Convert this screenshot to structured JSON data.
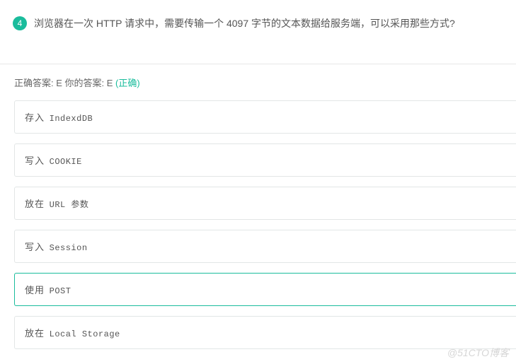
{
  "question": {
    "number": "4",
    "text": "浏览器在一次 HTTP 请求中，需要传输一个 4097 字节的文本数据给服务端，可以采用那些方式?"
  },
  "answer": {
    "correct_prefix": "正确答案: ",
    "correct_value": "E",
    "your_prefix": "   你的答案: ",
    "your_value": "E ",
    "status_open": "(",
    "status_text": "正确",
    "status_close": ")"
  },
  "options": [
    {
      "label": "存入 ",
      "code": "IndexdDB",
      "selected": false
    },
    {
      "label": "写入 ",
      "code": "COOKIE",
      "selected": false
    },
    {
      "label": "放在 ",
      "code": "URL 参数",
      "selected": false
    },
    {
      "label": "写入 ",
      "code": "Session",
      "selected": false
    },
    {
      "label": "使用 ",
      "code": "POST",
      "selected": true
    },
    {
      "label": "放在 ",
      "code": "Local Storage",
      "selected": false
    }
  ],
  "watermark": "@51CTO博客"
}
